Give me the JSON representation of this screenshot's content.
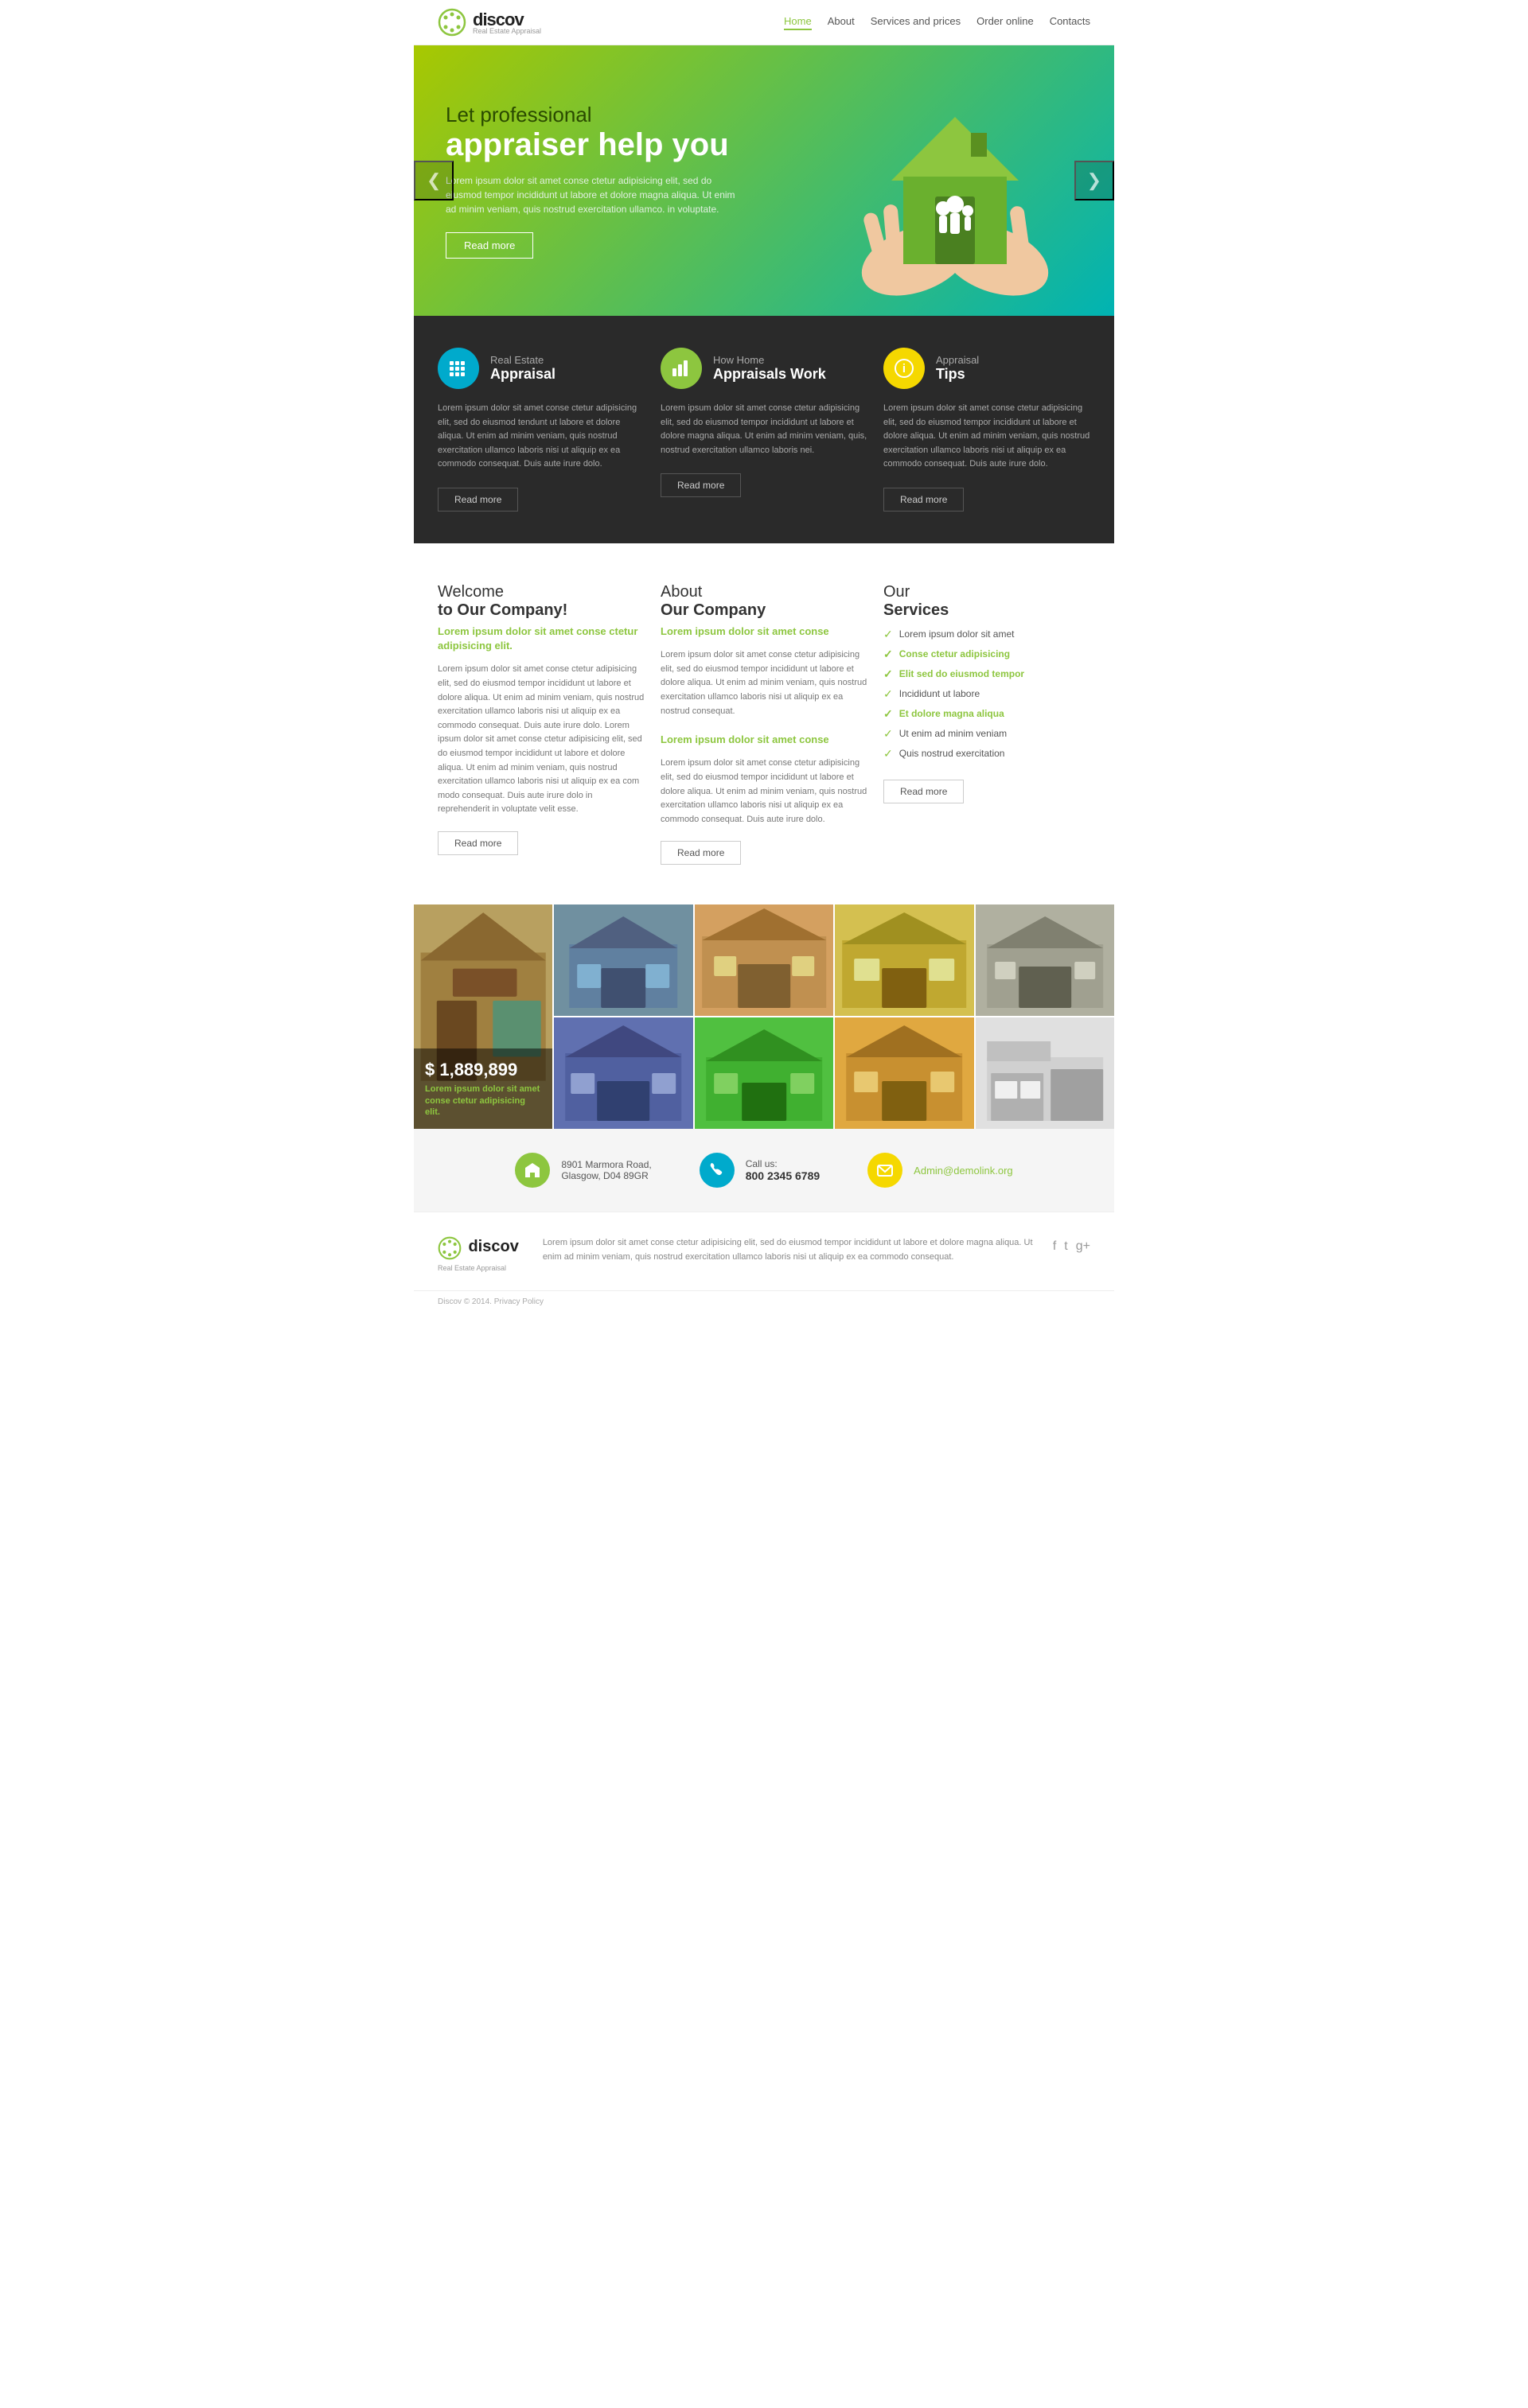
{
  "header": {
    "logo_text": "discov",
    "logo_sub": "Real Estate Appraisal",
    "nav": [
      {
        "label": "Home",
        "active": true
      },
      {
        "label": "About",
        "active": false
      },
      {
        "label": "Services and prices",
        "active": false
      },
      {
        "label": "Order online",
        "active": false
      },
      {
        "label": "Contacts",
        "active": false
      }
    ]
  },
  "hero": {
    "title_light": "Let professional",
    "title_bold": "appraiser help you",
    "text": "Lorem ipsum dolor sit amet conse ctetur adipisicing elit, sed do eiusmod tempor incididunt ut labore et dolore magna aliqua. Ut enim ad minim veniam, quis nostrud exercitation ullamco. in voluptate.",
    "btn_label": "Read more",
    "arrow_left": "❮",
    "arrow_right": "❯"
  },
  "dark_section": {
    "cards": [
      {
        "icon": "▦",
        "icon_class": "icon-blue",
        "title_light": "Real Estate",
        "title_bold": "Appraisal",
        "text": "Lorem ipsum dolor sit amet conse ctetur adipisicing elit, sed do eiusmod tendunt ut labore et dolore aliqua. Ut enim ad minim veniam, quis nostrud exercitation ullamco laboris nisi ut aliquip ex ea commodo consequat. Duis aute irure dolo.",
        "btn_label": "Read more"
      },
      {
        "icon": "▦",
        "icon_class": "icon-green",
        "title_light": "How Home",
        "title_bold": "Appraisals Work",
        "text": "Lorem ipsum dolor sit amet conse ctetur adipisicing elit, sed do eiusmod tempor incididunt ut labore et dolore magna aliqua. Ut enim ad minim veniam, quis, nostrud exercitation ullamco laboris nei.",
        "btn_label": "Read more"
      },
      {
        "icon": "ℹ",
        "icon_class": "icon-yellow",
        "title_light": "Appraisal",
        "title_bold": "Tips",
        "text": "Lorem ipsum dolor sit amet conse ctetur adipisicing elit, sed do eiusmod tempor incididunt ut labore et dolore aliqua. Ut enim ad minim veniam, quis nostrud exercitation ullamco laboris nisi ut aliquip ex ea commodo consequat. Duis aute irure dolo.",
        "btn_label": "Read more"
      }
    ]
  },
  "white_section": {
    "col1": {
      "title_normal": "Welcome",
      "title_bold": "to Our Company!",
      "accent": "Lorem ipsum dolor sit amet conse ctetur adipisicing elit.",
      "text1": "Lorem ipsum dolor sit amet conse ctetur adipisicing elit, sed do eiusmod tempor incididunt ut labore et dolore aliqua. Ut enim ad minim veniam, quis nostrud exercitation ullamco laboris nisi ut aliquip ex ea commodo consequat. Duis aute irure dolo. Lorem ipsum dolor sit amet conse ctetur adipisicing elit, sed do eiusmod tempor incididunt ut labore et dolore aliqua. Ut enim ad minim veniam, quis nostrud exercitation ullamco laboris nisi ut aliquip ex ea com modo consequat. Duis aute irure dolo in reprehenderit in voluptate velit esse.",
      "btn_label": "Read more"
    },
    "col2": {
      "title_normal": "About",
      "title_bold": "Our Company",
      "accent1": "Lorem ipsum dolor sit amet conse",
      "text1": "Lorem ipsum dolor sit amet conse ctetur adipisicing elit, sed do eiusmod tempor incididunt ut labore et dolore aliqua. Ut enim ad minim veniam, quis nostrud exercitation ullamco laboris nisi ut aliquip ex ea nostrud consequat.",
      "accent2": "Lorem ipsum dolor sit amet conse",
      "text2": "Lorem ipsum dolor sit amet conse ctetur adipisicing elit, sed do eiusmod tempor incididunt ut labore et dolore aliqua. Ut enim ad minim veniam, quis nostrud exercitation ullamco laboris nisi ut aliquip ex ea commodo consequat. Duis aute irure dolo.",
      "btn_label": "Read more"
    },
    "col3": {
      "title_normal": "Our",
      "title_bold": "Services",
      "services": [
        {
          "label": "Lorem ipsum dolor sit amet",
          "highlight": false
        },
        {
          "label": "Conse ctetur adipisicing",
          "highlight": true
        },
        {
          "label": "Elit sed do eiusmod tempor",
          "highlight": true
        },
        {
          "label": "Incididunt ut labore",
          "highlight": false
        },
        {
          "label": "Et dolore magna aliqua",
          "highlight": true
        },
        {
          "label": "Ut enim ad minim veniam",
          "highlight": false
        },
        {
          "label": "Quis nostrud exercitation",
          "highlight": false
        }
      ],
      "btn_label": "Read more"
    }
  },
  "gallery": {
    "featured_price": "$ 1,889,899",
    "featured_desc": "Lorem ipsum dolor sit amet conse ctetur adipisicing elit.",
    "items": [
      {
        "class": "gh1",
        "featured": true
      },
      {
        "class": "gh2"
      },
      {
        "class": "gh3"
      },
      {
        "class": "gh4"
      },
      {
        "class": "gh5"
      },
      {
        "class": "gh6"
      },
      {
        "class": "gh7"
      },
      {
        "class": "gh8"
      },
      {
        "class": "gh9"
      }
    ]
  },
  "footer_contact": {
    "address_label": "8901 Marmora Road,",
    "address_city": "Glasgow, D04 89GR",
    "call_label": "Call us:",
    "phone": "800 2345 6789",
    "email": "Admin@demolink.org"
  },
  "footer_bottom": {
    "logo_text": "discov",
    "logo_sub": "Real Estate Appraisal",
    "text": "Lorem ipsum dolor sit amet conse ctetur adipisicing elit, sed do eiusmod tempor incididunt ut labore et dolore magna aliqua. Ut enim ad minim veniam, quis nostrud exercitation ullamco laboris nisi ut aliquip ex ea commodo consequat.",
    "social": [
      "f",
      "t",
      "g+"
    ]
  },
  "footer_copy": {
    "text": "Discov © 2014.",
    "link": "Privacy Policy"
  }
}
